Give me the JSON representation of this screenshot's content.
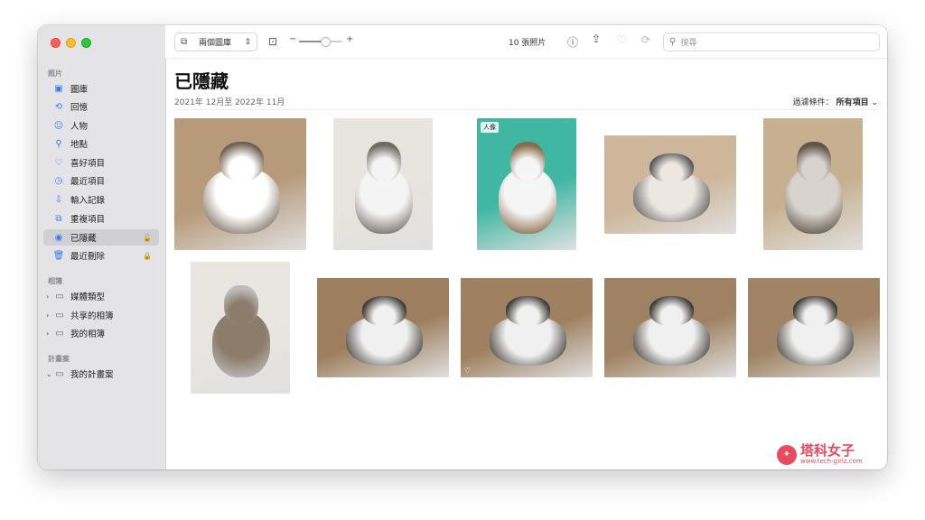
{
  "sidebar": {
    "sections": [
      {
        "title": "照片",
        "items": [
          {
            "label": "圖庫",
            "icon": "photo-library-icon",
            "glyph": "▣"
          },
          {
            "label": "回憶",
            "icon": "memories-icon",
            "glyph": "⟲"
          },
          {
            "label": "人物",
            "icon": "people-icon",
            "glyph": "☺"
          },
          {
            "label": "地點",
            "icon": "places-icon",
            "glyph": "⚲"
          },
          {
            "label": "喜好項目",
            "icon": "heart-icon",
            "glyph": "♡"
          },
          {
            "label": "最近項目",
            "icon": "clock-icon",
            "glyph": "◷"
          },
          {
            "label": "輸入記錄",
            "icon": "import-icon",
            "glyph": "⇩"
          },
          {
            "label": "重複項目",
            "icon": "duplicates-icon",
            "glyph": "⧉"
          },
          {
            "label": "已隱藏",
            "icon": "eye-icon",
            "glyph": "◉",
            "active": true,
            "lock": "🔓"
          },
          {
            "label": "最近刪除",
            "icon": "trash-icon",
            "glyph": "🗑",
            "lock": "🔒"
          }
        ]
      },
      {
        "title": "相簿",
        "items": [
          {
            "label": "媒體類型",
            "icon": "folder-icon",
            "glyph": "▭"
          },
          {
            "label": "共享的相簿",
            "icon": "folder-icon",
            "glyph": "▭"
          },
          {
            "label": "我的相簿",
            "icon": "folder-icon",
            "glyph": "▭"
          }
        ]
      },
      {
        "title": "計畫案",
        "items": [
          {
            "label": "我的計畫案",
            "icon": "folder-icon",
            "glyph": "▭",
            "expanded": true
          }
        ]
      }
    ]
  },
  "toolbar": {
    "view_select": "兩個圖庫",
    "zoom_minus": "−",
    "zoom_plus": "+",
    "zoom_level": 0.6,
    "photo_count": "10 張照片",
    "search_placeholder": "搜尋"
  },
  "content": {
    "title": "已隱藏",
    "date_range": "2021年 12月至 2022年 11月",
    "filter_label": "過濾條件：",
    "filter_value": "所有項目"
  },
  "photos": [
    {
      "bg": "#b69a7a",
      "cat": "#ffffff",
      "accent": "#6d5f50"
    },
    {
      "bg": "#e8e4de",
      "cat": "#f4f4f4",
      "accent": "#6f6a63"
    },
    {
      "bg": "#3fb7a3",
      "cat": "#f5f5f5",
      "accent": "#8b6a4a",
      "badge": "人像"
    },
    {
      "bg": "#cdb699",
      "cat": "#ece7e1",
      "accent": "#5a5a5a"
    },
    {
      "bg": "#c7b08f",
      "cat": "#d8d3cc",
      "accent": "#5f5549"
    },
    {
      "bg": "#e9e5e0",
      "cat": "#8c7c6a",
      "accent": "#bdbdbd"
    },
    {
      "bg": "#9d7f5f",
      "cat": "#f0f0f0",
      "accent": "#3f3a35"
    },
    {
      "bg": "#9f8161",
      "cat": "#f0f0f0",
      "accent": "#3f3a35",
      "heart": "♡"
    },
    {
      "bg": "#9f8263",
      "cat": "#f0f0f0",
      "accent": "#3f3a35"
    },
    {
      "bg": "#a08465",
      "cat": "#f0f0f0",
      "accent": "#3f3a35"
    }
  ],
  "watermark": {
    "text": "塔科女子",
    "url": "www.tech-girlz.com"
  }
}
